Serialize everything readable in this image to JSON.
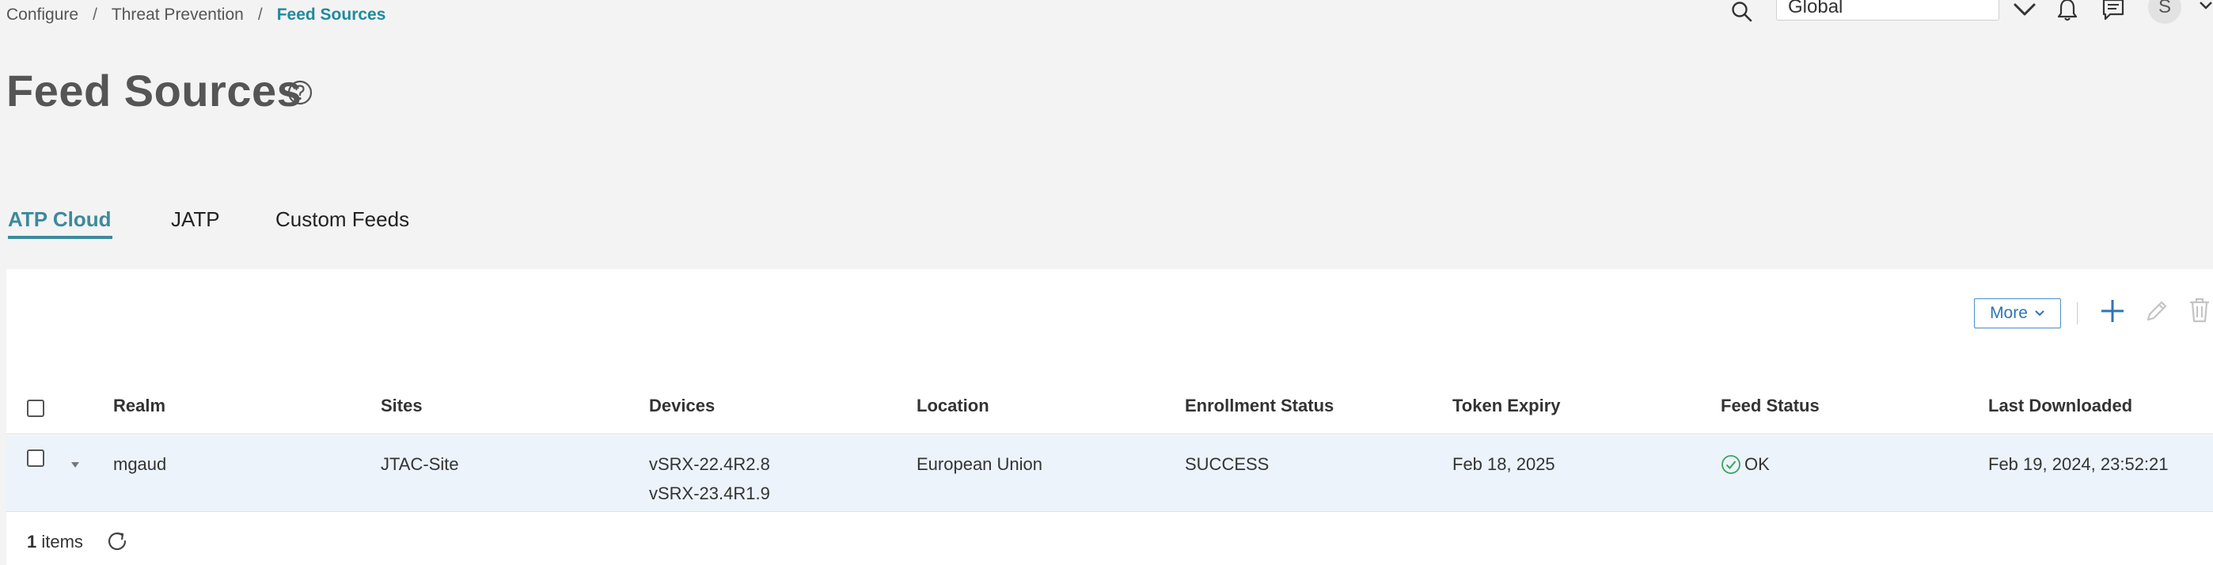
{
  "breadcrumb": {
    "items": [
      "Configure",
      "Threat Prevention"
    ],
    "current": "Feed Sources",
    "separator": "/"
  },
  "header": {
    "scope_value": "Global",
    "avatar_initial": "S"
  },
  "page": {
    "title": "Feed Sources"
  },
  "tabs": [
    {
      "label": "ATP Cloud",
      "active": true
    },
    {
      "label": "JATP",
      "active": false
    },
    {
      "label": "Custom Feeds",
      "active": false
    }
  ],
  "toolbar": {
    "more_label": "More"
  },
  "table": {
    "columns": [
      "Realm",
      "Sites",
      "Devices",
      "Location",
      "Enrollment Status",
      "Token Expiry",
      "Feed Status",
      "Last Downloaded"
    ],
    "rows": [
      {
        "realm": "mgaud",
        "sites": "JTAC-Site",
        "devices": [
          "vSRX-22.4R2.8",
          "vSRX-23.4R1.9"
        ],
        "location": "European Union",
        "enrollment_status": "SUCCESS",
        "token_expiry": "Feb 18, 2025",
        "feed_status": "OK",
        "last_downloaded": "Feb 19, 2024, 23:52:21"
      }
    ],
    "footer": {
      "count": "1",
      "count_suffix": " items"
    }
  },
  "colors": {
    "accent": "#3d8a9c",
    "breadcrumb_current": "#1f8aa0",
    "row_highlight": "#ecf3fb",
    "link_blue": "#2f74b5",
    "ok_green": "#3aa35a"
  },
  "icons": {
    "search": "search-icon",
    "chevron": "chevron-down-icon",
    "bell": "bell-icon",
    "chat": "chat-icon",
    "help": "help-icon",
    "plus": "plus-icon",
    "pencil": "pencil-icon",
    "trash": "trash-icon",
    "ok": "check-circle-icon",
    "refresh": "refresh-icon"
  }
}
